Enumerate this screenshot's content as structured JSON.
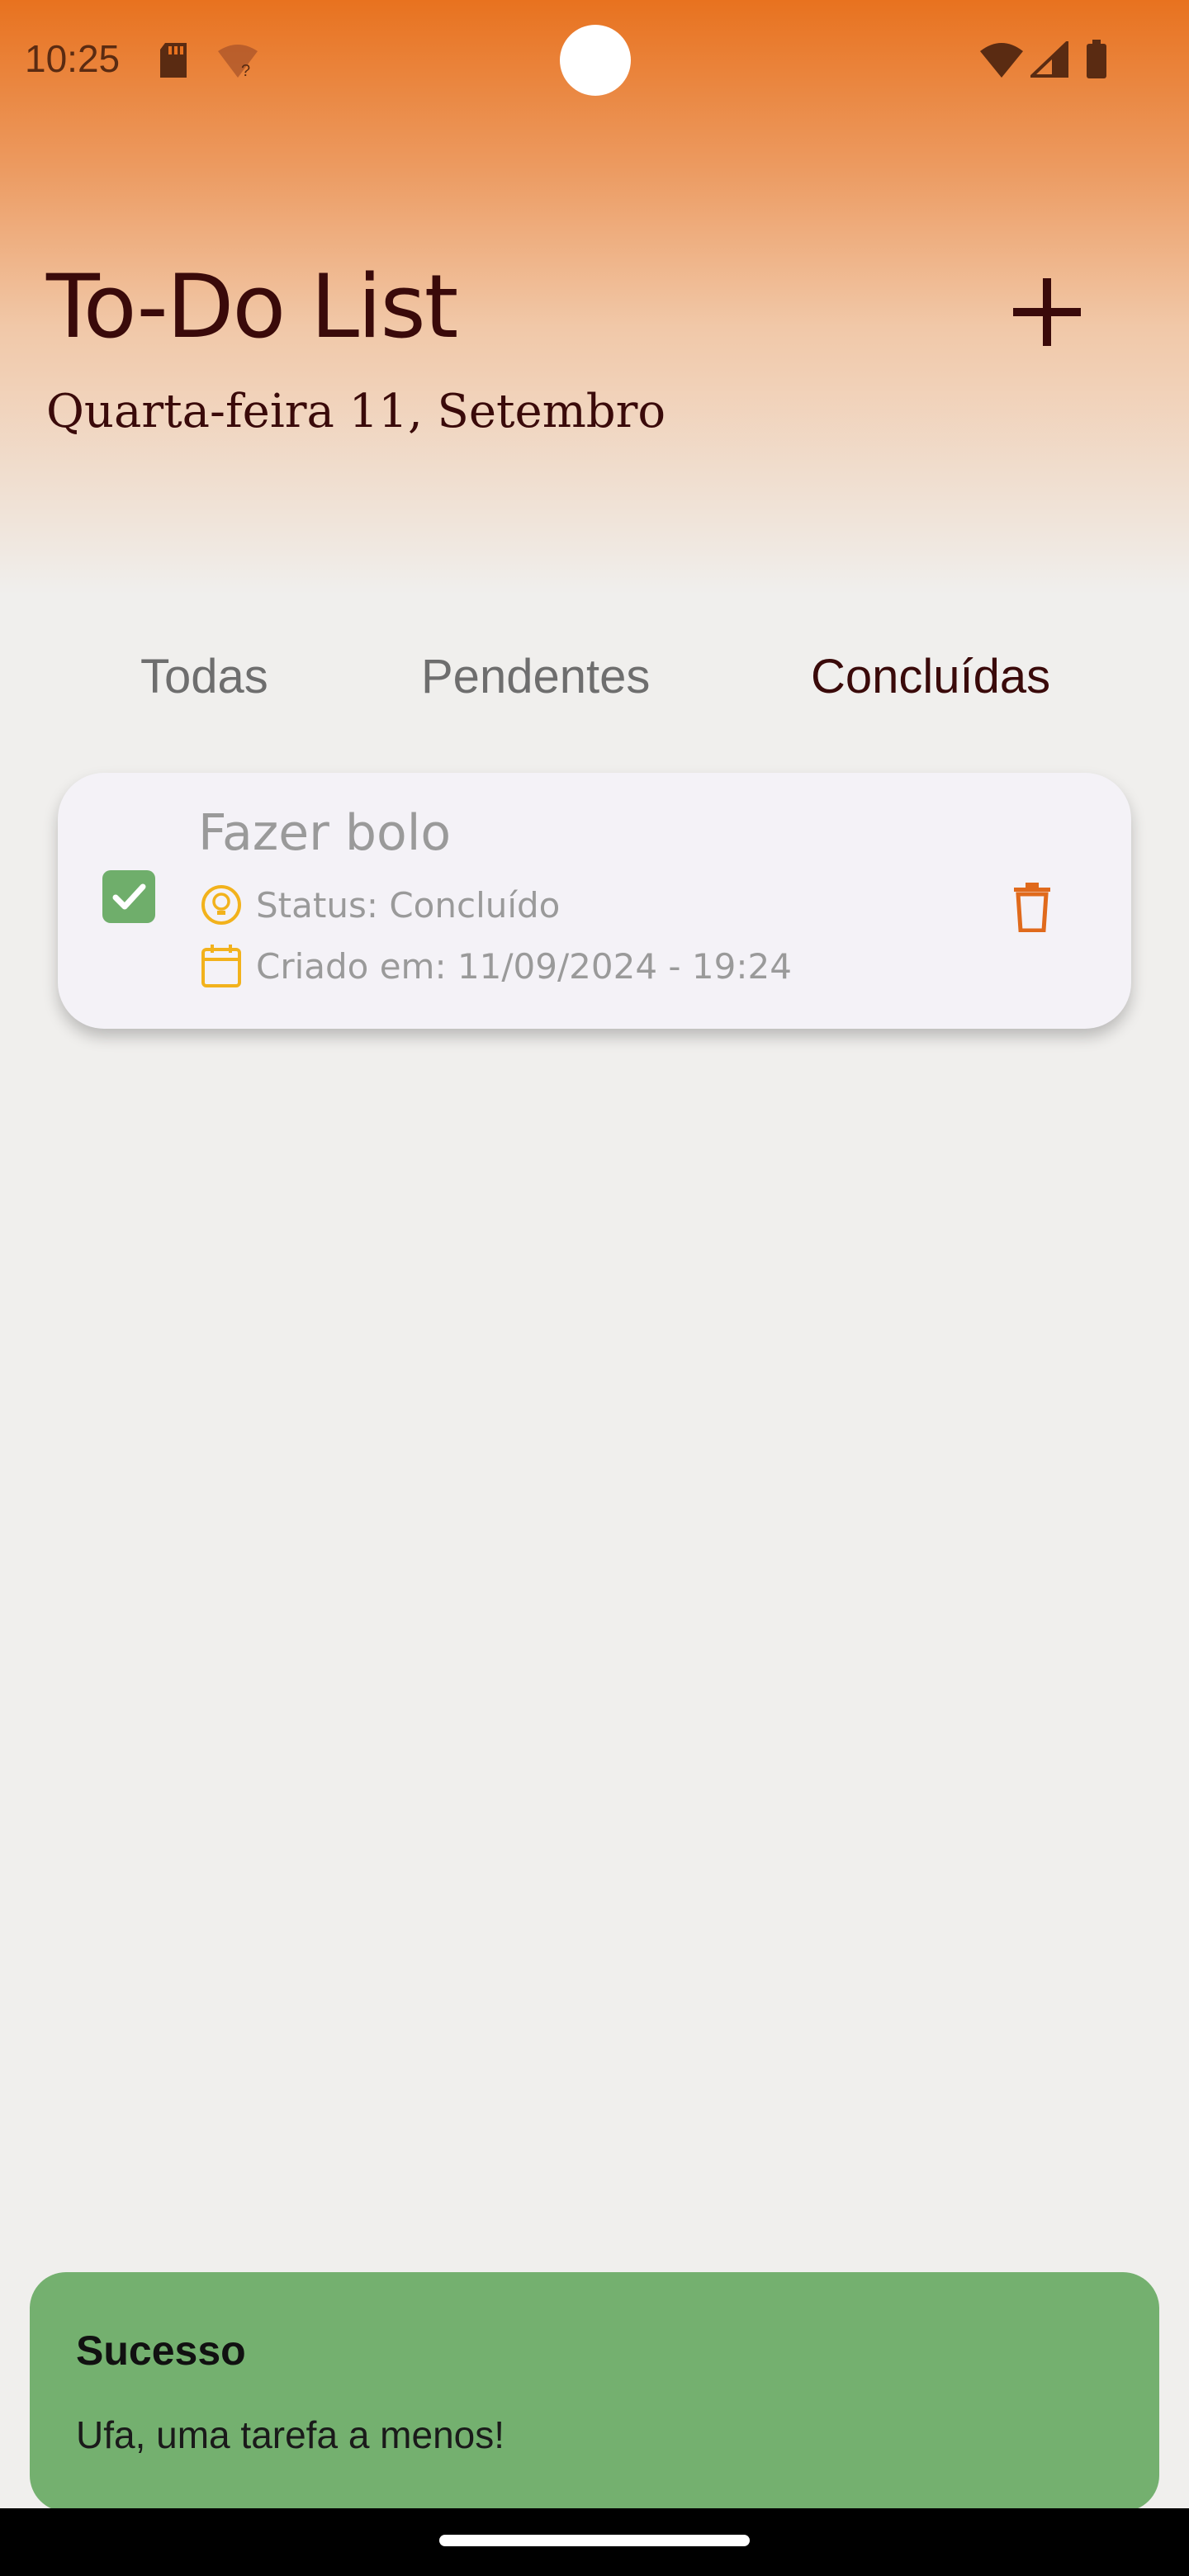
{
  "status_bar": {
    "time": "10:25",
    "icons": [
      "sd-card-icon",
      "wifi-question-icon",
      "wifi-icon",
      "cellular-signal-icon",
      "battery-icon"
    ]
  },
  "header": {
    "title": "To-Do List",
    "date": "Quarta-feira 11, Setembro",
    "add_icon": "plus-icon"
  },
  "tabs": [
    {
      "label": "Todas",
      "active": false
    },
    {
      "label": "Pendentes",
      "active": false
    },
    {
      "label": "Concluídas",
      "active": true
    }
  ],
  "tasks": [
    {
      "title": "Fazer bolo",
      "checked": true,
      "status": "Status: Concluído",
      "created": "Criado em: 11/09/2024 - 19:24"
    }
  ],
  "snackbar": {
    "title": "Sucesso",
    "message": "Ufa, uma tarefa a menos!"
  },
  "colors": {
    "accent": "#e8721f",
    "title_text": "#3a0a0a",
    "check_green": "#6fae6b",
    "meta_icon_yellow": "#f2b21c",
    "delete_orange": "#e06a1c",
    "snackbar_bg": "#74b06f"
  }
}
